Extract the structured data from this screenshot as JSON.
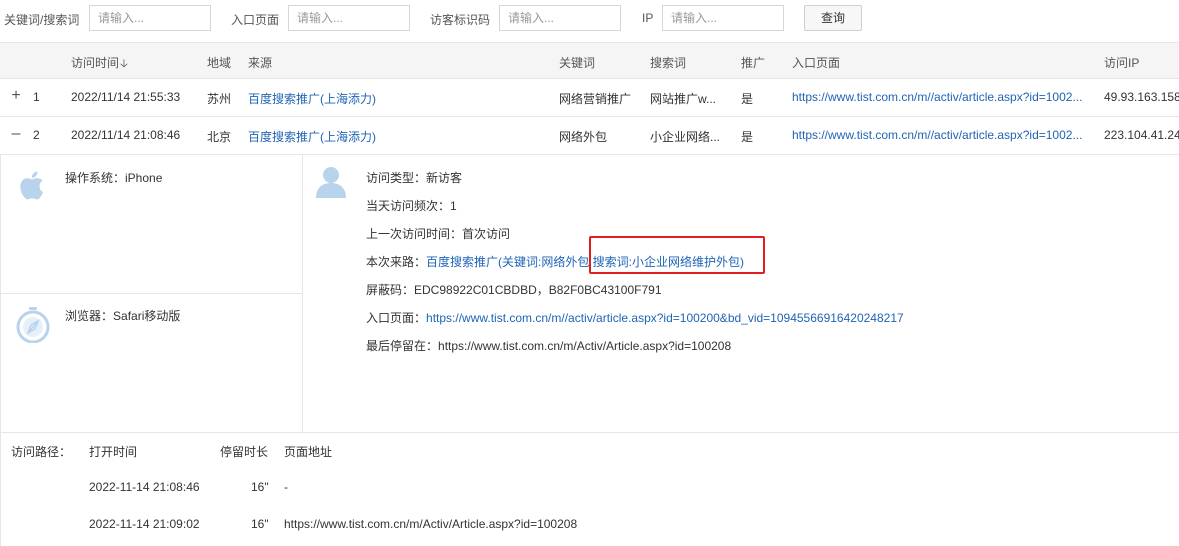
{
  "filters": {
    "keyword_label": "关键词/搜索词",
    "keyword_placeholder": "请输入...",
    "entry_label": "入口页面",
    "entry_placeholder": "请输入...",
    "visitor_label": "访客标识码",
    "visitor_placeholder": "请输入...",
    "ip_label": "IP",
    "ip_placeholder": "请输入...",
    "query_button": "查询"
  },
  "table": {
    "headers": {
      "time": "访问时间",
      "region": "地域",
      "source": "来源",
      "keyword": "关键词",
      "search": "搜索词",
      "promo": "推广",
      "entry": "入口页面",
      "ip": "访问IP"
    },
    "rows": [
      {
        "toggle": "+",
        "index": "1",
        "time": "2022/11/14 21:55:33",
        "region": "苏州",
        "source": "百度搜索推广(上海添力)",
        "keyword": "网络营销推广",
        "search": "网站推广w...",
        "promo": "是",
        "entry": "https://www.tist.com.cn/m//activ/article.aspx?id=1002...",
        "ip": "49.93.163.158"
      },
      {
        "toggle": "–",
        "index": "2",
        "time": "2022/11/14 21:08:46",
        "region": "北京",
        "source": "百度搜索推广(上海添力)",
        "keyword": "网络外包",
        "search": "小企业网络...",
        "promo": "是",
        "entry": "https://www.tist.com.cn/m//activ/article.aspx?id=1002...",
        "ip": "223.104.41.24"
      }
    ]
  },
  "detail": {
    "os_label": "操作系统：",
    "os_value": "iPhone",
    "browser_label": "浏览器：",
    "browser_value": "Safari移动版",
    "visit_type_label": "访问类型：",
    "visit_type_value": "新访客",
    "daily_freq_label": "当天访问频次：",
    "daily_freq_value": "1",
    "last_visit_label": "上一次访问时间：",
    "last_visit_value": "首次访问",
    "source_label": "本次来路：",
    "source_value": "百度搜索推广(关键词:网络外包 搜索词:小企业网络维护外包)",
    "mask_label": "屏蔽码：",
    "mask_value": "EDC98922C01CBDBD，B82F0BC43100F791",
    "entry_label": "入口页面：",
    "entry_value": "https://www.tist.com.cn/m//activ/article.aspx?id=100200&bd_vid=10945566916420248217",
    "last_stay_label": "最后停留在：",
    "last_stay_value": "https://www.tist.com.cn/m/Activ/Article.aspx?id=100208",
    "icons": {
      "os": "apple-icon",
      "browser": "safari-compass-icon",
      "visitor": "user-icon"
    },
    "highlight_color": "#e02020"
  },
  "path": {
    "label": "访问路径：",
    "headers": {
      "open_time": "打开时间",
      "duration": "停留时长",
      "page": "页面地址"
    },
    "rows": [
      {
        "open_time": "2022-11-14 21:08:46",
        "duration": "16\"",
        "page": "-"
      },
      {
        "open_time": "2022-11-14 21:09:02",
        "duration": "16\"",
        "page": "https://www.tist.com.cn/m/Activ/Article.aspx?id=100208"
      }
    ]
  },
  "colors": {
    "link": "#1f64b5",
    "icon": "#b9d3ec"
  }
}
